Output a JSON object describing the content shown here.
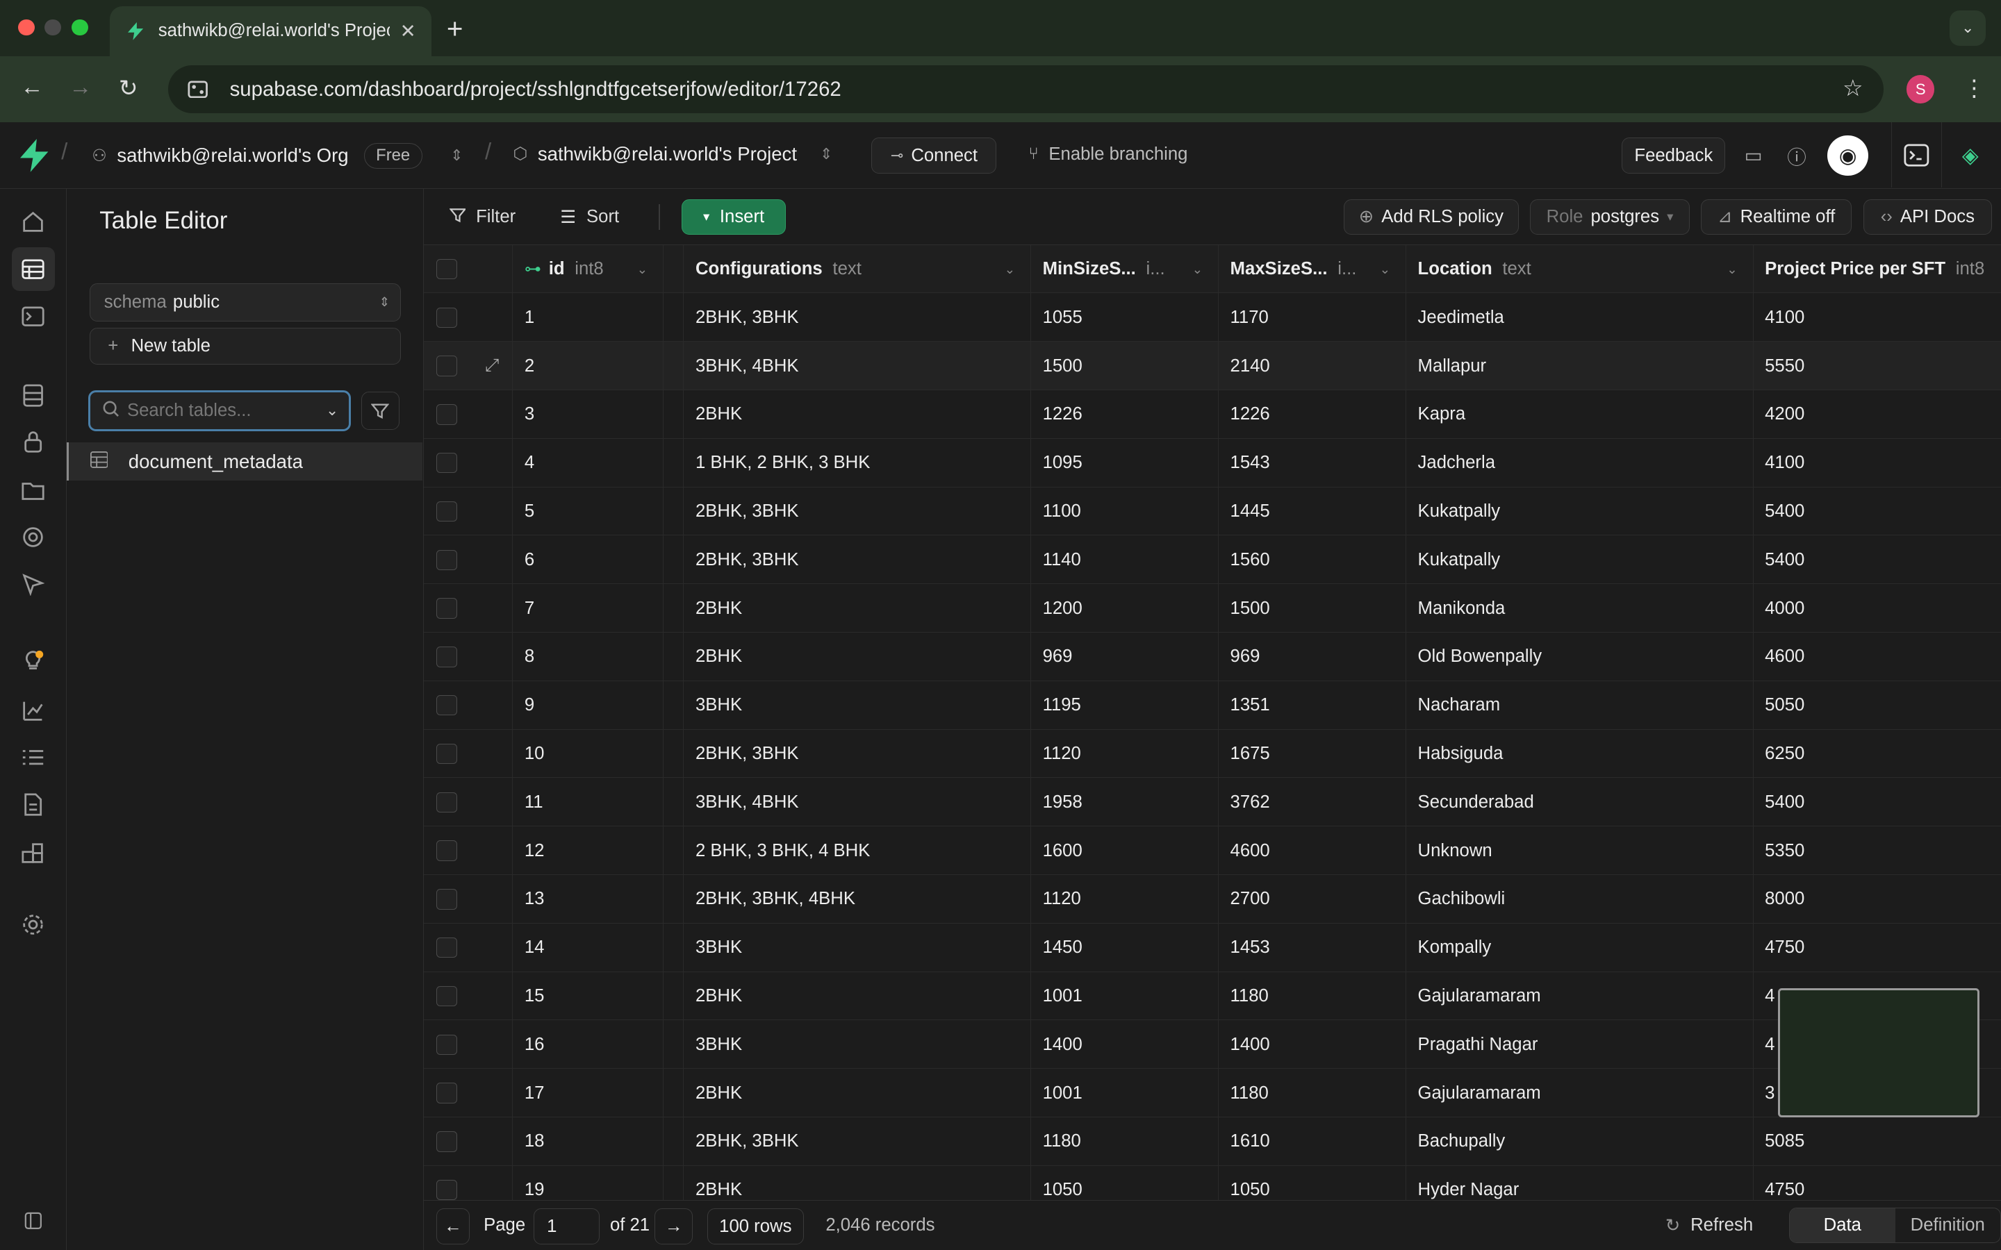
{
  "browser": {
    "tab_title": "sathwikb@relai.world's Project",
    "url": "supabase.com/dashboard/project/sshlgndtfgcetserjfow/editor/17262",
    "profile_initial": "S"
  },
  "header": {
    "org": "sathwikb@relai.world's Org",
    "plan": "Free",
    "project": "sathwikb@relai.world's Project",
    "connect": "Connect",
    "branching": "Enable branching",
    "feedback": "Feedback"
  },
  "sidebar": {
    "title": "Table Editor",
    "schema_label": "schema",
    "schema_value": "public",
    "new_table": "New table",
    "search_placeholder": "Search tables...",
    "tables": [
      "document_metadata"
    ]
  },
  "toolbar": {
    "filter": "Filter",
    "sort": "Sort",
    "insert": "Insert",
    "add_rls": "Add RLS policy",
    "role_label": "Role",
    "role_value": "postgres",
    "realtime": "Realtime off",
    "api_docs": "API Docs"
  },
  "columns": [
    {
      "name": "id",
      "type": "int8"
    },
    {
      "name": "Configurations",
      "type": "text"
    },
    {
      "name": "MinSizeS...",
      "type": "i..."
    },
    {
      "name": "MaxSizeS...",
      "type": "i..."
    },
    {
      "name": "Location",
      "type": "text"
    },
    {
      "name": "Project Price per SFT",
      "type": "int8"
    }
  ],
  "rows": [
    [
      "1",
      "2BHK, 3BHK",
      "1055",
      "1170",
      "Jeedimetla",
      "4100"
    ],
    [
      "2",
      "3BHK, 4BHK",
      "1500",
      "2140",
      "Mallapur",
      "5550"
    ],
    [
      "3",
      "2BHK",
      "1226",
      "1226",
      "Kapra",
      "4200"
    ],
    [
      "4",
      "1 BHK, 2 BHK, 3 BHK",
      "1095",
      "1543",
      "Jadcherla",
      "4100"
    ],
    [
      "5",
      "2BHK, 3BHK",
      "1100",
      "1445",
      "Kukatpally",
      "5400"
    ],
    [
      "6",
      "2BHK, 3BHK",
      "1140",
      "1560",
      "Kukatpally",
      "5400"
    ],
    [
      "7",
      "2BHK",
      "1200",
      "1500",
      "Manikonda",
      "4000"
    ],
    [
      "8",
      "2BHK",
      "969",
      "969",
      "Old Bowenpally",
      "4600"
    ],
    [
      "9",
      "3BHK",
      "1195",
      "1351",
      "Nacharam",
      "5050"
    ],
    [
      "10",
      "2BHK, 3BHK",
      "1120",
      "1675",
      "Habsiguda",
      "6250"
    ],
    [
      "11",
      "3BHK, 4BHK",
      "1958",
      "3762",
      "Secunderabad",
      "5400"
    ],
    [
      "12",
      "2 BHK, 3 BHK, 4 BHK",
      "1600",
      "4600",
      "Unknown",
      "5350"
    ],
    [
      "13",
      "2BHK, 3BHK, 4BHK",
      "1120",
      "2700",
      "Gachibowli",
      "8000"
    ],
    [
      "14",
      "3BHK",
      "1450",
      "1453",
      "Kompally",
      "4750"
    ],
    [
      "15",
      "2BHK",
      "1001",
      "1180",
      "Gajularamaram",
      "4"
    ],
    [
      "16",
      "3BHK",
      "1400",
      "1400",
      "Pragathi Nagar",
      "4"
    ],
    [
      "17",
      "2BHK",
      "1001",
      "1180",
      "Gajularamaram",
      "3"
    ],
    [
      "18",
      "2BHK, 3BHK",
      "1180",
      "1610",
      "Bachupally",
      "5085"
    ],
    [
      "19",
      "2BHK",
      "1050",
      "1050",
      "Hyder Nagar",
      "4750"
    ]
  ],
  "footer": {
    "page_label": "Page",
    "page_value": "1",
    "of_pages": "of 21",
    "rows_per_page": "100 rows",
    "records": "2,046 records",
    "refresh": "Refresh",
    "tab_data": "Data",
    "tab_definition": "Definition"
  },
  "colors": {
    "accent": "#3ecf8e",
    "insert_bg": "#1f7a4d",
    "background": "#1c1c1c"
  }
}
